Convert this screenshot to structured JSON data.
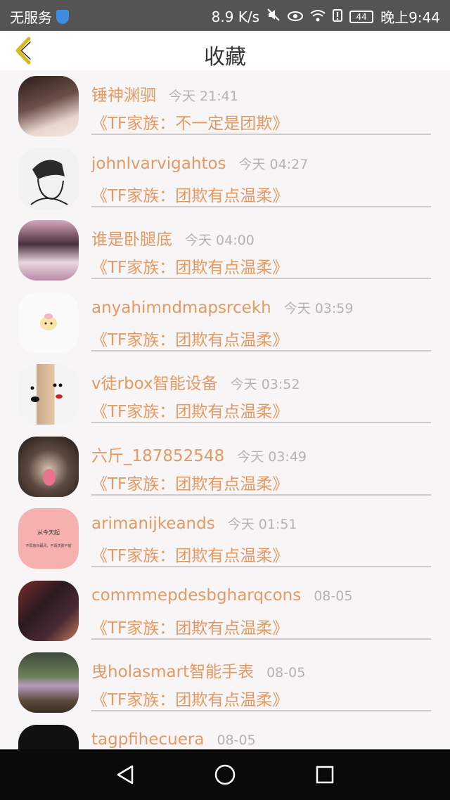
{
  "status_bar": {
    "carrier": "无服务",
    "speed": "8.9 K/s",
    "battery": "44",
    "time": "晚上9:44"
  },
  "header": {
    "title": "收藏"
  },
  "items": [
    {
      "name": "锤神渊驷",
      "time": "今天 21:41",
      "topic": "《TF家族：不一定是团欺》",
      "avatar_color": "#6b5048"
    },
    {
      "name": "johnlvarvigahtos",
      "time": "今天 04:27",
      "topic": "《TF家族：团欺有点温柔》",
      "avatar_color": "#f2f2f2"
    },
    {
      "name": "谁是卧腿底",
      "time": "今天 04:00",
      "topic": "《TF家族：团欺有点温柔》",
      "avatar_color": "#b78aa8"
    },
    {
      "name": "anyahimndmapsrcekh",
      "time": "今天 03:59",
      "topic": "《TF家族：团欺有点温柔》",
      "avatar_color": "#fafafa"
    },
    {
      "name": "v徒rbox智能设备",
      "time": "今天 03:52",
      "topic": "《TF家族：团欺有点温柔》",
      "avatar_color": "#c9a98c"
    },
    {
      "name": "六斤_187852548",
      "time": "今天 03:49",
      "topic": "《TF家族：团欺有点温柔》",
      "avatar_color": "#5d4a40"
    },
    {
      "name": "arimanijkeands",
      "time": "今天 01:51",
      "topic": "《TF家族：团欺有点温柔》",
      "avatar_color": "#f6b0b0",
      "avatar_text_1": "从今天起",
      "avatar_text_2": "不再盲目跟风，不再犹豫不前"
    },
    {
      "name": "commmepdesbgharqcons",
      "time": "08-05",
      "topic": "《TF家族：团欺有点温柔》",
      "avatar_color": "#4a2a35"
    },
    {
      "name": "曳holasmart智能手表",
      "time": "08-05",
      "topic": "《TF家族：团欺有点温柔》",
      "avatar_color": "#6b7f5a"
    },
    {
      "name": "tagpfihecuera",
      "time": "08-05",
      "topic": "",
      "avatar_color": "#111111"
    }
  ],
  "colors": {
    "accent": "#e39a63",
    "status_bar": "#545454",
    "nav_bar": "#0a0a0a",
    "back_arrow": "#d8b81c"
  }
}
